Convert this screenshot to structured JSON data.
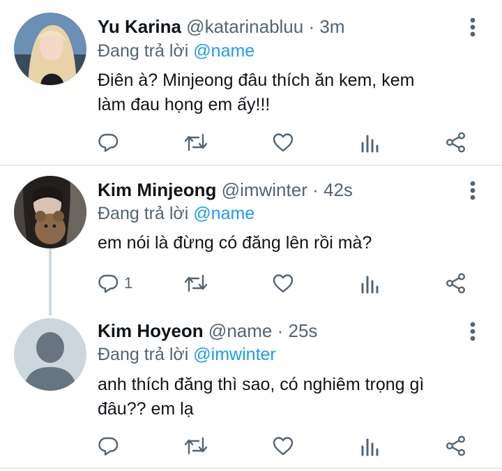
{
  "tweets": [
    {
      "name": "Yu Karina",
      "handle": "@katarinabluu",
      "dot": "·",
      "time": "3m",
      "reply_prefix": "Đang trả lời",
      "reply_to": "@name",
      "text_lines": [
        "Điên à? Minjeong đâu thích ăn kem, kem",
        "làm đau họng em ấy!!!"
      ],
      "reply_count": ""
    },
    {
      "name": "Kim Minjeong",
      "handle": "@imwinter",
      "dot": "·",
      "time": "42s",
      "reply_prefix": "Đang trả lời",
      "reply_to": "@name",
      "text_lines": [
        "em nói là đừng có đăng lên rồi mà?"
      ],
      "reply_count": "1"
    },
    {
      "name": "Kim Hoyeon",
      "handle": "@name",
      "dot": "·",
      "time": "25s",
      "reply_prefix": "Đang trả lời",
      "reply_to": "@imwinter",
      "text_lines": [
        "anh thích đăng thì sao, có nghiêm trọng gì",
        "đâu?? em lạ"
      ],
      "reply_count": ""
    }
  ],
  "colors": {
    "accent": "#1d9bf0",
    "muted": "#536471",
    "divider": "#e6ecf0"
  },
  "icons": [
    "reply-icon",
    "retweet-icon",
    "like-icon",
    "analytics-icon",
    "share-icon",
    "more-icon"
  ]
}
